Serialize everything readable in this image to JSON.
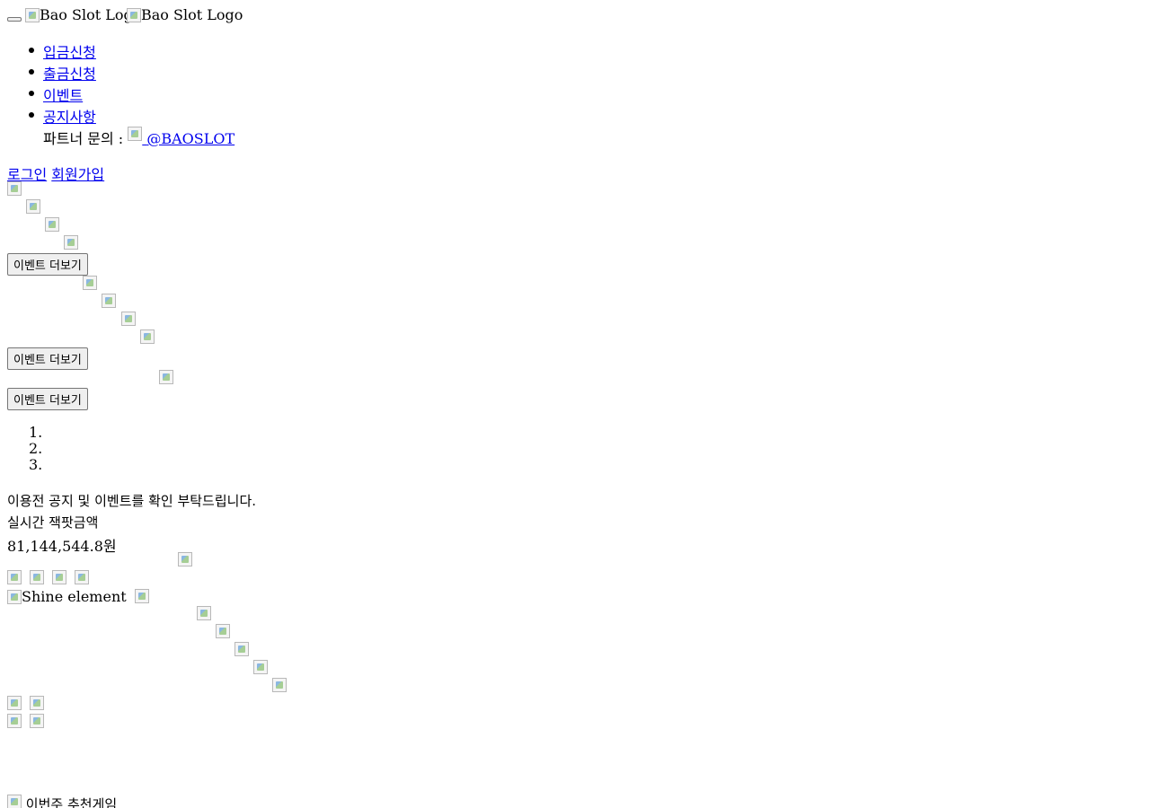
{
  "header": {
    "logo_alt_1": "Bao Slot Logo",
    "logo_alt_2": "Bao Slot Logo"
  },
  "nav": {
    "items": [
      {
        "label": "입금신청"
      },
      {
        "label": "출금신청"
      },
      {
        "label": "이벤트"
      },
      {
        "label": "공지사항"
      }
    ],
    "partner_label": "파트너 문의 :",
    "partner_link": "@BAOSLOT"
  },
  "auth": {
    "login": "로그인",
    "signup": "회원가입"
  },
  "events": {
    "more_label": "이벤트 더보기"
  },
  "carousel": {
    "indicators": [
      "1.",
      "2.",
      "3."
    ]
  },
  "notice": {
    "text": "이용전 공지 및 이벤트를 확인 부탁드립니다."
  },
  "jackpot": {
    "label": "실시간 잭팟금액",
    "amount": "81,144,544.8원"
  },
  "shine": {
    "alt": "Shine element"
  },
  "recommend": {
    "title": "이번주 추천게임"
  }
}
